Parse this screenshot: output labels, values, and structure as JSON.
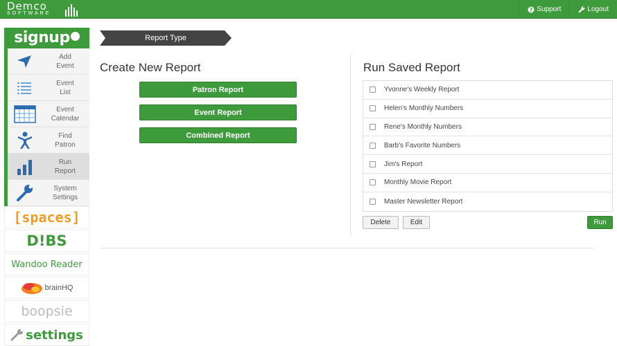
{
  "brand": {
    "name": "Demco",
    "subtitle": "SOFTWARE"
  },
  "topnav": [
    {
      "icon": "question-circle-icon",
      "label": "Support"
    },
    {
      "icon": "wrench-icon",
      "label": "Logout"
    }
  ],
  "sidebar": {
    "logo": "signup",
    "items": [
      {
        "label_line1": "Add",
        "label_line2": "Event",
        "icon": "paper-plane-icon",
        "active": false
      },
      {
        "label_line1": "Event",
        "label_line2": "List",
        "icon": "list-icon",
        "active": false
      },
      {
        "label_line1": "Event",
        "label_line2": "Calendar",
        "icon": "calendar-icon",
        "active": false
      },
      {
        "label_line1": "Find",
        "label_line2": "Patron",
        "icon": "person-icon",
        "active": false
      },
      {
        "label_line1": "Run",
        "label_line2": "Report",
        "icon": "bar-chart-icon",
        "active": true
      },
      {
        "label_line1": "System",
        "label_line2": "Settings",
        "icon": "wrench-icon",
        "active": false
      }
    ],
    "partners": {
      "spaces": "[spaces]",
      "dibs": "D!BS",
      "wandoo": "Wandoo Reader",
      "brainhq": "brainHQ",
      "boopsie": "boopsie",
      "settings": "settings"
    }
  },
  "main": {
    "step_banner": "Report Type",
    "create": {
      "title": "Create New Report",
      "buttons": [
        "Patron Report",
        "Event Report",
        "Combined Report"
      ]
    },
    "saved": {
      "title": "Run Saved Report",
      "reports": [
        "Yvonne's Weekly Report",
        "Helen's Monthly Numbers",
        "Rene's Monthly Numbers",
        "Barb's Favorite Numbers",
        "Jim's Report",
        "Monthly Movie Report",
        "Master Newsletter Report"
      ],
      "delete_label": "Delete",
      "edit_label": "Edit",
      "run_label": "Run"
    }
  },
  "colors": {
    "accent": "#3e9b3c",
    "accent_dark": "#2f7c2e",
    "banner": "#444444",
    "spaces": "#f59a1c"
  }
}
